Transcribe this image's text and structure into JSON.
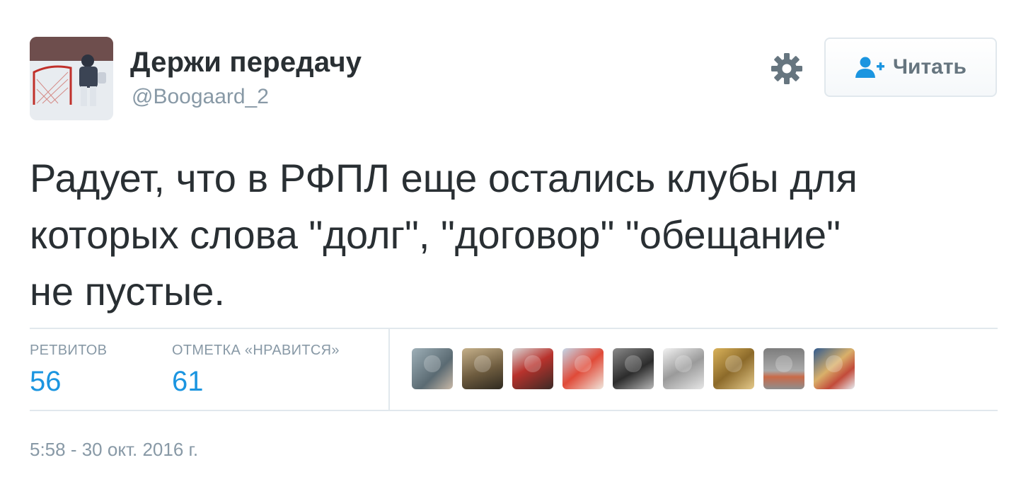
{
  "user": {
    "name": "Держи передачу",
    "handle": "@Boogaard_2"
  },
  "follow": {
    "label": "Читать"
  },
  "tweet": {
    "text": "Радует, что в РФПЛ еще остались клубы для\nкоторых слова \"долг\", \"договор\" \"обещание\"\nне пустые."
  },
  "stats": {
    "retweets_label": "РЕТВИТОВ",
    "retweets_count": "56",
    "likes_label": "ОТМЕТКА «НРАВИТСЯ»",
    "likes_count": "61"
  },
  "timestamp": "5:58 - 30 окт. 2016 г.",
  "colors": {
    "accent": "#1b95e0",
    "muted": "#8899a6",
    "text": "#292f33",
    "border": "#e1e8ed"
  },
  "icons": {
    "settings": "gear-icon",
    "follow": "follow-user-icon"
  }
}
